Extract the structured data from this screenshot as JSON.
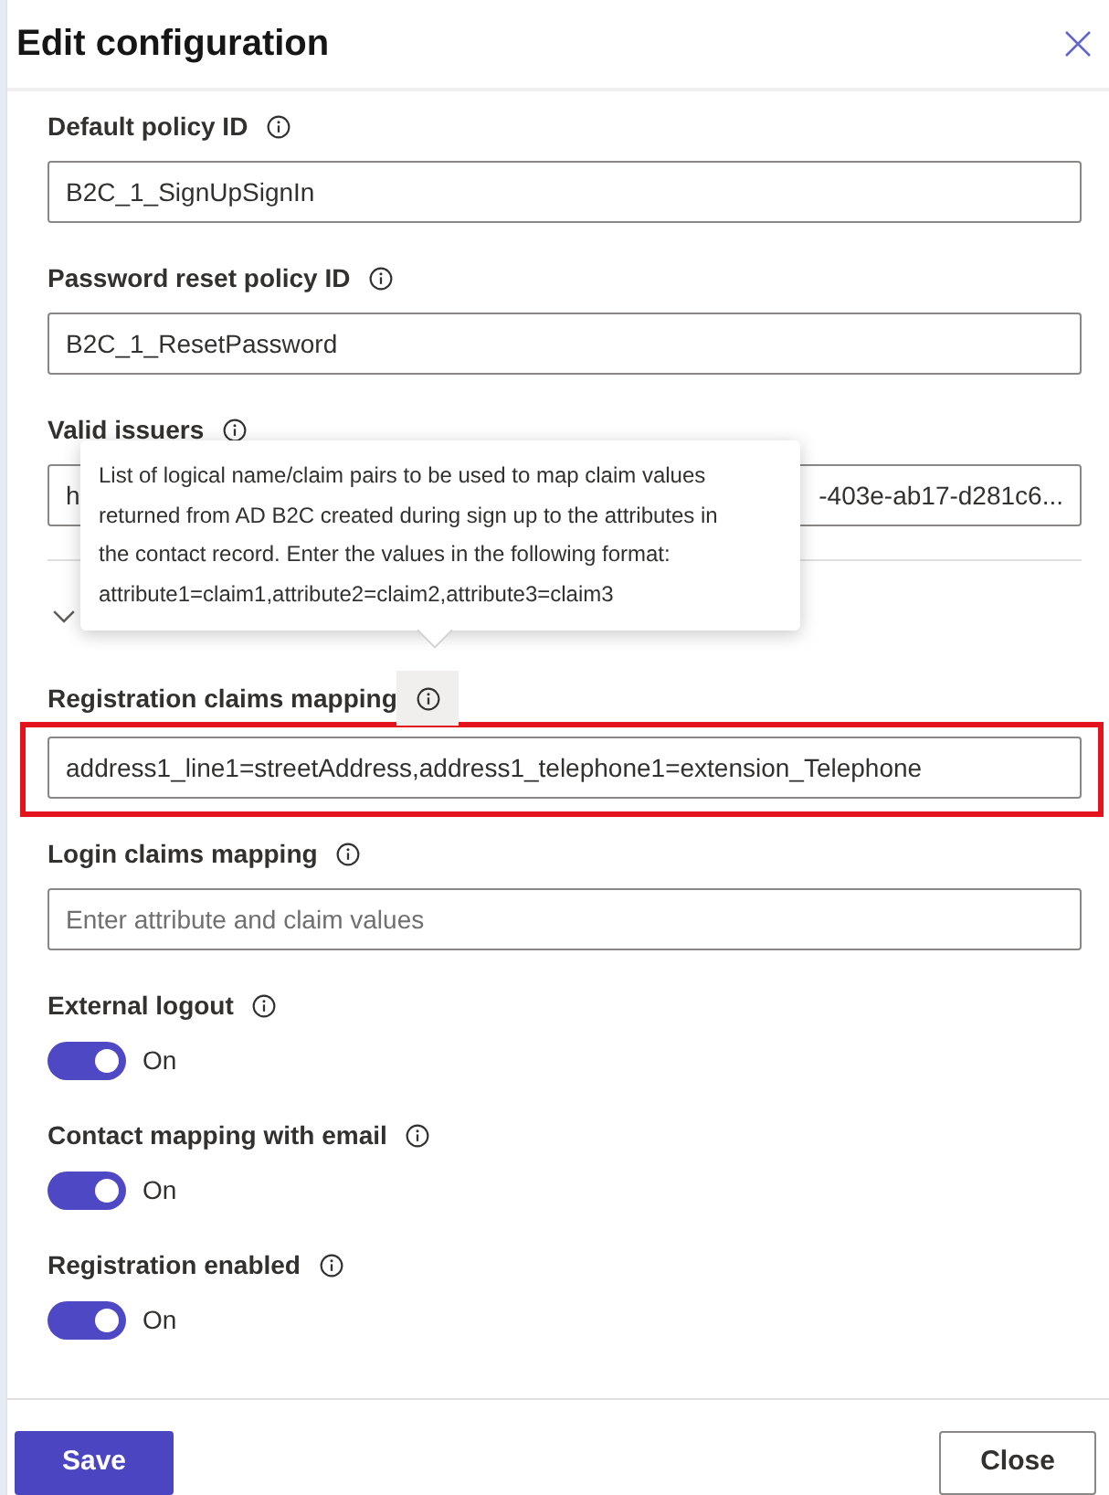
{
  "dialog": {
    "title": "Edit configuration"
  },
  "fields": [
    {
      "kind": "text",
      "label": "Default policy ID",
      "info": true,
      "info_hovered": false,
      "value": "B2C_1_SignUpSignIn"
    },
    {
      "kind": "text",
      "label": "Password reset policy ID",
      "info": true,
      "info_hovered": false,
      "value": "B2C_1_ResetPassword"
    },
    {
      "kind": "text",
      "label": "Valid issuers",
      "info": true,
      "info_hovered": false,
      "value_left": "h",
      "value_right": "-403e-ab17-d281c6..."
    },
    {
      "kind": "section",
      "expanded": true
    },
    {
      "kind": "text",
      "label": "Registration claims mapping",
      "info": true,
      "info_hovered": true,
      "highlighted": true,
      "value": "address1_line1=streetAddress,address1_telephone1=extension_Telephone"
    },
    {
      "kind": "text",
      "label": "Login claims mapping",
      "info": true,
      "info_hovered": false,
      "placeholder": "Enter attribute and claim values"
    },
    {
      "kind": "toggle",
      "label": "External logout",
      "info": true,
      "info_hovered": false,
      "on": true,
      "state_text": "On"
    },
    {
      "kind": "toggle",
      "label": "Contact mapping with email",
      "info": true,
      "info_hovered": false,
      "on": true,
      "state_text": "On"
    },
    {
      "kind": "toggle",
      "label": "Registration enabled",
      "info": true,
      "info_hovered": false,
      "on": true,
      "state_text": "On"
    }
  ],
  "tooltip": {
    "text": "List of logical name/claim pairs to be used to map claim values returned from AD B2C created during sign up to the attributes in the contact record. Enter the values in the following format: attribute1=claim1,attribute2=claim2,attribute3=claim3"
  },
  "buttons": [
    {
      "label": "Save",
      "kind": "primary"
    },
    {
      "label": "Close",
      "kind": "secondary"
    }
  ]
}
